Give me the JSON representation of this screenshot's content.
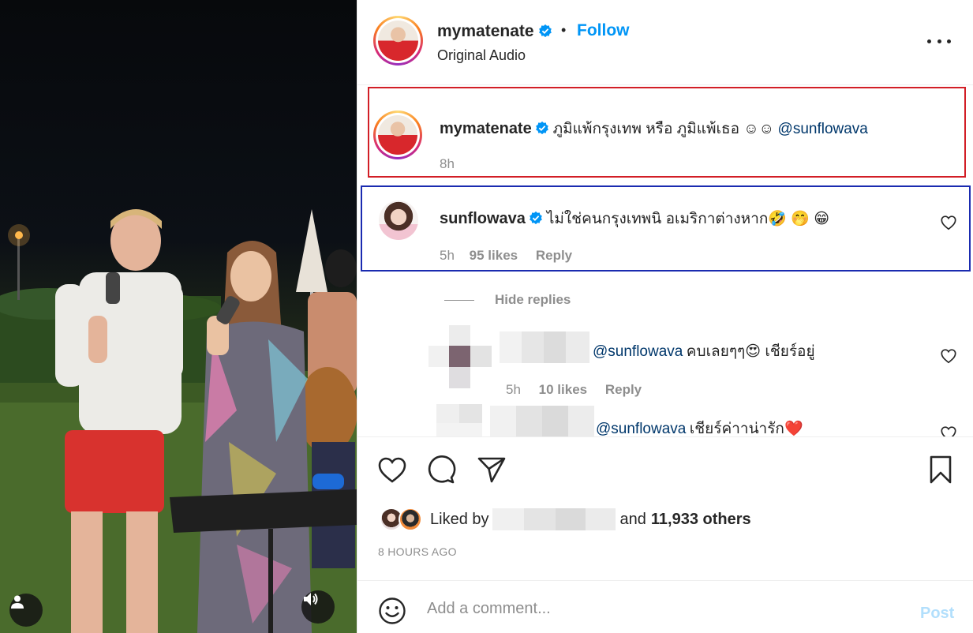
{
  "post": {
    "username": "mymatenate",
    "follow_label": "Follow",
    "separator": "•",
    "audio_label": "Original Audio"
  },
  "caption": {
    "username": "mymatenate",
    "text": "ภูมิแพ้กรุงเทพ หรือ ภูมิแพ้เธอ ☺☺",
    "mention": "@sunflowava",
    "time": "8h"
  },
  "comment": {
    "username": "sunflowava",
    "text": "ไม่ใช่คนกรุงเทพนิ อเมริกาต่างหาก🤣 🤭 😁",
    "time": "5h",
    "likes": "95 likes",
    "reply_label": "Reply",
    "hide_replies_label": "Hide replies"
  },
  "replies": [
    {
      "mention": "@sunflowava",
      "text": "คบเลยๆๆ😍 เชียร์อยู่",
      "time": "5h",
      "likes": "10 likes",
      "reply_label": "Reply"
    },
    {
      "mention": "@sunflowava",
      "text": "เชียร์ค่าาน่ารัก❤️"
    }
  ],
  "likes_summary": {
    "prefix": "Liked by",
    "suffix_text": "and",
    "others": "11,933 others",
    "time_ago": "8 HOURS AGO"
  },
  "comment_box": {
    "placeholder": "Add a comment...",
    "post_label": "Post"
  },
  "colors": {
    "link_blue": "#0095f6",
    "mention_blue": "#00376b",
    "annotation_red": "#d21e26",
    "annotation_blue": "#1a2bb0",
    "post_disabled": "#b2dffc",
    "muted": "#8e8e8e"
  },
  "icons": {
    "more": "more-horizontal-icon",
    "like": "heart-icon",
    "comment": "comment-bubble-icon",
    "share": "paper-plane-icon",
    "save": "bookmark-icon",
    "emoji": "emoji-smile-icon",
    "verified": "verified-badge-icon",
    "user": "user-tag-icon",
    "sound": "speaker-icon"
  }
}
